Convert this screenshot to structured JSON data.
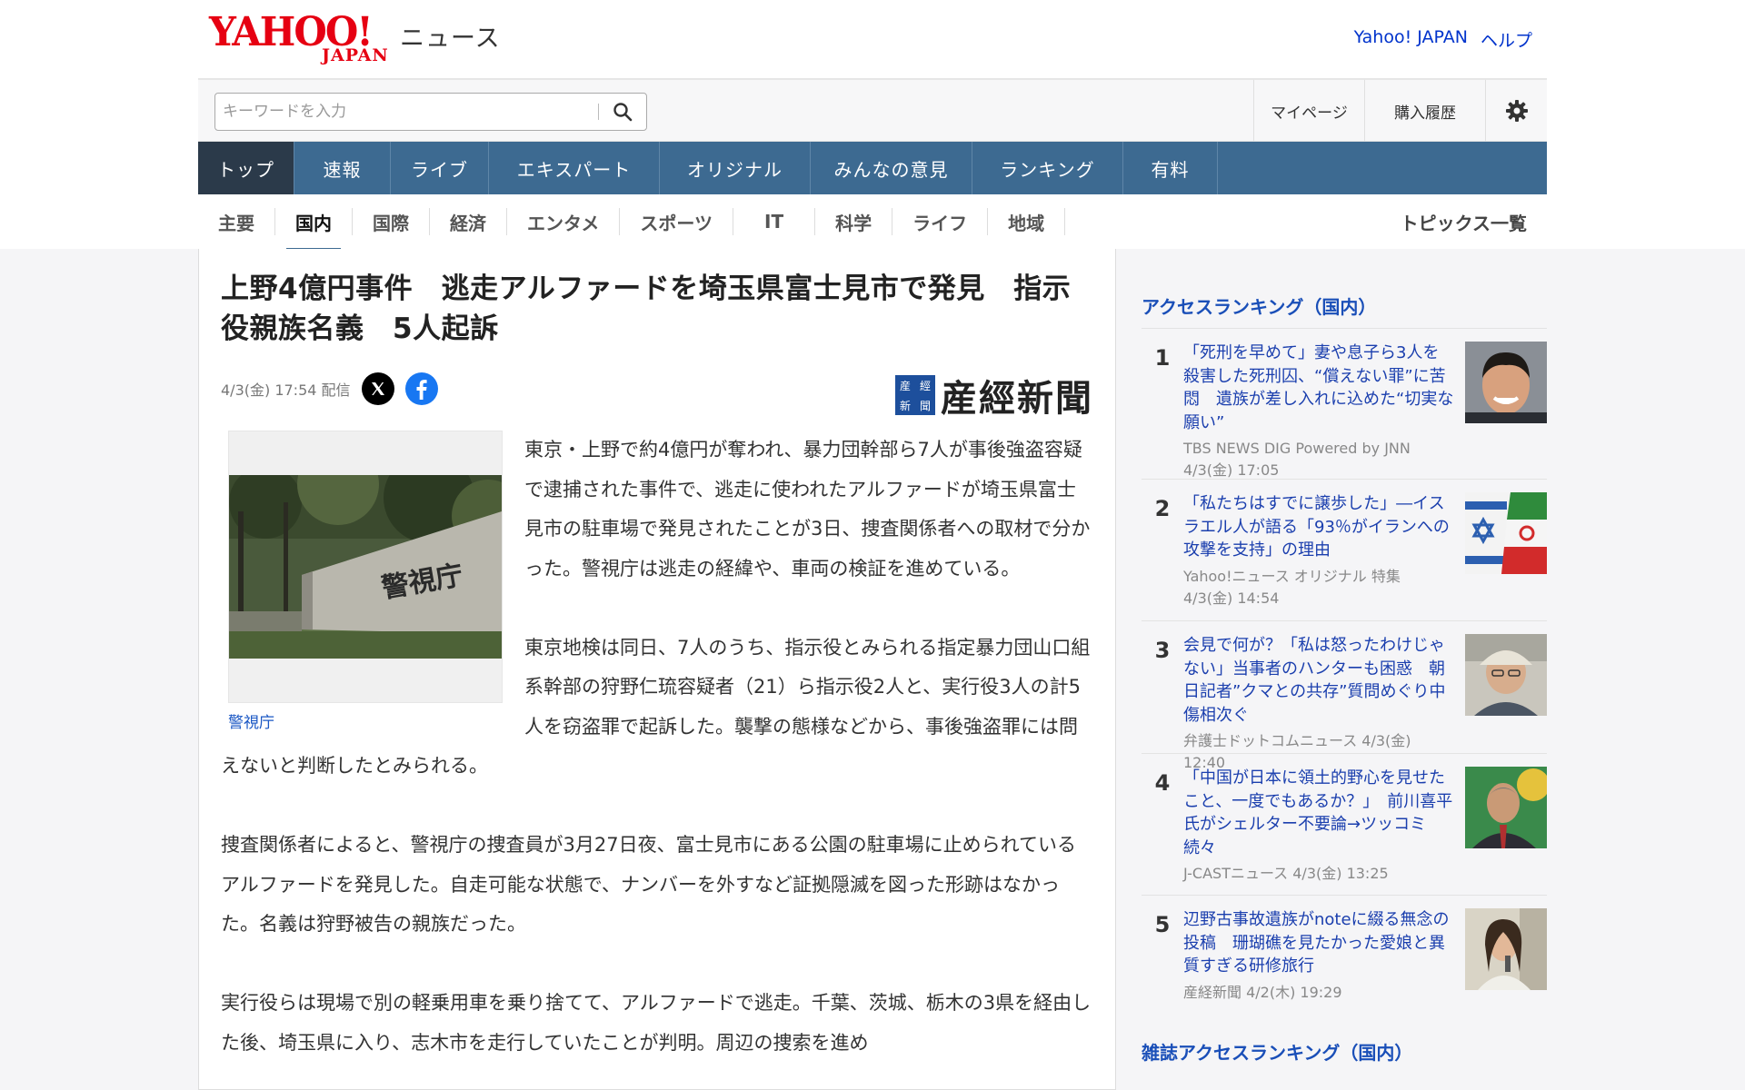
{
  "header": {
    "logo_text": "YAHOO!",
    "logo_sub": "JAPAN",
    "section": "ニュース",
    "links": [
      "Yahoo! JAPAN",
      "ヘルプ"
    ]
  },
  "search": {
    "placeholder": "キーワードを入力"
  },
  "user_links": {
    "mypage": "マイページ",
    "history": "購入履歴"
  },
  "main_nav": [
    "トップ",
    "速報",
    "ライブ",
    "エキスパート",
    "オリジナル",
    "みんなの意見",
    "ランキング",
    "有料"
  ],
  "main_nav_active": "トップ",
  "sub_nav": [
    "主要",
    "国内",
    "国際",
    "経済",
    "エンタメ",
    "スポーツ",
    "IT",
    "科学",
    "ライフ",
    "地域"
  ],
  "sub_nav_active": "国内",
  "topics_link": "トピックス一覧",
  "article": {
    "title": "上野4億円事件　逃走アルファードを埼玉県富士見市で発見　指示役親族名義　5人起訴",
    "date": "4/3(金) 17:54 配信",
    "publisher": "産經新聞",
    "publisher_mark": [
      "産",
      "經",
      "新",
      "聞"
    ],
    "image_caption": "警視庁",
    "image_sign_text": "警視庁",
    "paragraphs": [
      "東京・上野で約4億円が奪われ、暴力団幹部ら7人が事後強盗容疑で逮捕された事件で、逃走に使われたアルファードが埼玉県富士見市の駐車場で発見されたことが3日、捜査関係者への取材で分かった。警視庁は逃走の経緯や、車両の検証を進めている。",
      "東京地検は同日、7人のうち、指示役とみられる指定暴力団山口組系幹部の狩野仁琉容疑者（21）ら指示役2人と、実行役3人の計5人を窃盗罪で起訴した。襲撃の態様などから、事後強盗罪には問えないと判断したとみられる。",
      "捜査関係者によると、警視庁の捜査員が3月27日夜、富士見市にある公園の駐車場に止められているアルファードを発見した。自走可能な状態で、ナンバーを外すなど証拠隠滅を図った形跡はなかった。名義は狩野被告の親族だった。",
      "実行役らは現場で別の軽乗用車を乗り捨てて、アルファードで逃走。千葉、茨城、栃木の3県を経由した後、埼玉県に入り、志木市を走行していたことが判明。周辺の捜索を進め"
    ]
  },
  "sidebar": {
    "title": "アクセスランキング（国内）",
    "items": [
      {
        "rank": "1",
        "title": "「死刑を早めて」妻や息子ら3人を殺害した死刑囚、“償えない罪”に苦悶　遺族が差し入れに込めた“切実な願い”",
        "source": "TBS NEWS DIG Powered by JNN",
        "time": "4/3(金) 17:05"
      },
      {
        "rank": "2",
        "title": "「私たちはすでに譲歩した」―イスラエル人が語る「93％がイランへの攻撃を支持」の理由",
        "source": "Yahoo!ニュース オリジナル 特集",
        "time": "4/3(金) 14:54"
      },
      {
        "rank": "3",
        "title": "会見で何が？「私は怒ったわけじゃない」当事者のハンターも困惑　朝日記者”クマとの共存”質問めぐり中傷相次ぐ",
        "source": "弁護士ドットコムニュース 4/3(金) 12:40",
        "time": ""
      },
      {
        "rank": "4",
        "title": "「中国が日本に領土的野心を見せたこと、一度でもあるか？」　前川喜平氏がシェルター不要論→ツッコミ続々",
        "source": "J-CASTニュース 4/3(金) 13:25",
        "time": ""
      },
      {
        "rank": "5",
        "title": "辺野古事故遺族がnoteに綴る無念の投稿　珊瑚礁を見たかった愛娘と異質すぎる研修旅行",
        "source": "産経新聞 4/2(木) 19:29",
        "time": ""
      }
    ],
    "next_title": "雑誌アクセスランキング（国内）"
  }
}
